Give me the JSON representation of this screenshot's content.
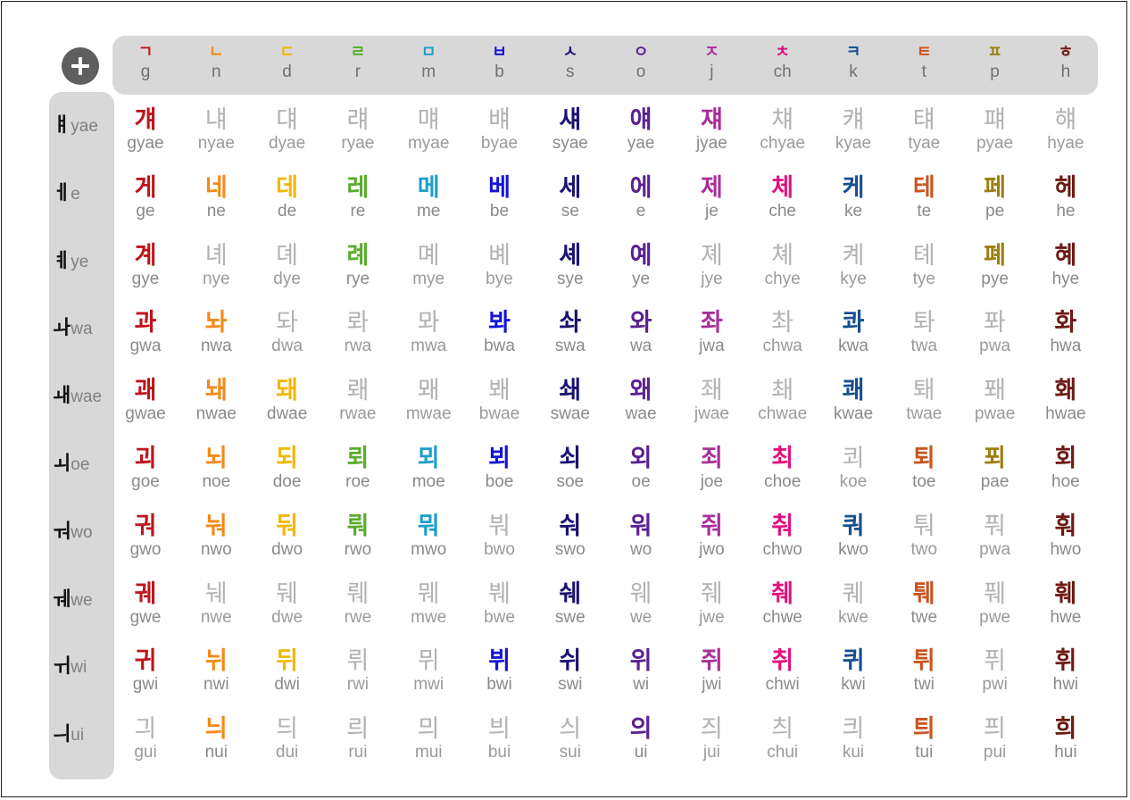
{
  "controls": {
    "add_icon": "plus-circle-icon"
  },
  "consonants": [
    {
      "jamo": "ㄱ",
      "rom": "g",
      "color": "#c0141c"
    },
    {
      "jamo": "ㄴ",
      "rom": "n",
      "color": "#f28a17"
    },
    {
      "jamo": "ㄷ",
      "rom": "d",
      "color": "#f2b705"
    },
    {
      "jamo": "ㄹ",
      "rom": "r",
      "color": "#5aac2e"
    },
    {
      "jamo": "ㅁ",
      "rom": "m",
      "color": "#1e9fc9"
    },
    {
      "jamo": "ㅂ",
      "rom": "b",
      "color": "#1414d6"
    },
    {
      "jamo": "ㅅ",
      "rom": "s",
      "color": "#1a1270"
    },
    {
      "jamo": "ㅇ",
      "rom": "o",
      "color": "#5b2190"
    },
    {
      "jamo": "ㅈ",
      "rom": "j",
      "color": "#a8309a"
    },
    {
      "jamo": "ㅊ",
      "rom": "ch",
      "color": "#e0127e"
    },
    {
      "jamo": "ㅋ",
      "rom": "k",
      "color": "#174f8f"
    },
    {
      "jamo": "ㅌ",
      "rom": "t",
      "color": "#c95420"
    },
    {
      "jamo": "ㅍ",
      "rom": "p",
      "color": "#9c7f10"
    },
    {
      "jamo": "ㅎ",
      "rom": "h",
      "color": "#6e1a14"
    }
  ],
  "rows": [
    {
      "vowel": "ㅒ",
      "vowel_rom": "yae",
      "syllables": [
        "걔",
        "냬",
        "댸",
        "럐",
        "먜",
        "뱨",
        "섀",
        "얘",
        "쟤",
        "챼",
        "컈",
        "턔",
        "퍠",
        "햬"
      ],
      "roms": [
        "gyae",
        "nyae",
        "dyae",
        "ryae",
        "myae",
        "byae",
        "syae",
        "yae",
        "jyae",
        "chyae",
        "kyae",
        "tyae",
        "pyae",
        "hyae"
      ],
      "active": [
        true,
        false,
        false,
        false,
        false,
        false,
        true,
        true,
        true,
        false,
        false,
        false,
        false,
        false
      ]
    },
    {
      "vowel": "ㅔ",
      "vowel_rom": "e",
      "syllables": [
        "게",
        "네",
        "데",
        "레",
        "메",
        "베",
        "세",
        "에",
        "제",
        "체",
        "케",
        "테",
        "페",
        "헤"
      ],
      "roms": [
        "ge",
        "ne",
        "de",
        "re",
        "me",
        "be",
        "se",
        "e",
        "je",
        "che",
        "ke",
        "te",
        "pe",
        "he"
      ],
      "active": [
        true,
        true,
        true,
        true,
        true,
        true,
        true,
        true,
        true,
        true,
        true,
        true,
        true,
        true
      ]
    },
    {
      "vowel": "ㅖ",
      "vowel_rom": "ye",
      "syllables": [
        "계",
        "녜",
        "뎨",
        "례",
        "몌",
        "볘",
        "셰",
        "예",
        "졔",
        "쳬",
        "켸",
        "톄",
        "폐",
        "혜"
      ],
      "roms": [
        "gye",
        "nye",
        "dye",
        "rye",
        "mye",
        "bye",
        "sye",
        "ye",
        "jye",
        "chye",
        "kye",
        "tye",
        "pye",
        "hye"
      ],
      "active": [
        true,
        false,
        false,
        true,
        false,
        false,
        true,
        true,
        false,
        false,
        false,
        false,
        true,
        true
      ]
    },
    {
      "vowel": "ㅘ",
      "vowel_rom": "wa",
      "syllables": [
        "과",
        "놔",
        "돠",
        "롸",
        "뫄",
        "봐",
        "솨",
        "와",
        "좌",
        "촤",
        "콰",
        "톼",
        "퐈",
        "화"
      ],
      "roms": [
        "gwa",
        "nwa",
        "dwa",
        "rwa",
        "mwa",
        "bwa",
        "swa",
        "wa",
        "jwa",
        "chwa",
        "kwa",
        "twa",
        "pwa",
        "hwa"
      ],
      "active": [
        true,
        true,
        false,
        false,
        false,
        true,
        true,
        true,
        true,
        false,
        true,
        false,
        false,
        true
      ]
    },
    {
      "vowel": "ㅙ",
      "vowel_rom": "wae",
      "syllables": [
        "괘",
        "놰",
        "돼",
        "뢔",
        "뫠",
        "봬",
        "쇄",
        "왜",
        "좨",
        "쵀",
        "쾌",
        "퇘",
        "퐤",
        "홰"
      ],
      "roms": [
        "gwae",
        "nwae",
        "dwae",
        "rwae",
        "mwae",
        "bwae",
        "swae",
        "wae",
        "jwae",
        "chwae",
        "kwae",
        "twae",
        "pwae",
        "hwae"
      ],
      "active": [
        true,
        true,
        true,
        false,
        false,
        false,
        true,
        true,
        false,
        false,
        true,
        false,
        false,
        true
      ]
    },
    {
      "vowel": "ㅚ",
      "vowel_rom": "oe",
      "syllables": [
        "괴",
        "뇌",
        "되",
        "뢰",
        "뫼",
        "뵈",
        "쇠",
        "외",
        "죄",
        "최",
        "쾨",
        "퇴",
        "푀",
        "회"
      ],
      "roms": [
        "goe",
        "noe",
        "doe",
        "roe",
        "moe",
        "boe",
        "soe",
        "oe",
        "joe",
        "choe",
        "koe",
        "toe",
        "pae",
        "hoe"
      ],
      "active": [
        true,
        true,
        true,
        true,
        true,
        true,
        true,
        true,
        true,
        true,
        false,
        true,
        true,
        true
      ]
    },
    {
      "vowel": "ㅝ",
      "vowel_rom": "wo",
      "syllables": [
        "궈",
        "눠",
        "둬",
        "뤄",
        "뭐",
        "붜",
        "숴",
        "워",
        "줘",
        "춰",
        "쿼",
        "퉈",
        "풔",
        "훠"
      ],
      "roms": [
        "gwo",
        "nwo",
        "dwo",
        "rwo",
        "mwo",
        "bwo",
        "swo",
        "wo",
        "jwo",
        "chwo",
        "kwo",
        "two",
        "pwa",
        "hwo"
      ],
      "active": [
        true,
        true,
        true,
        true,
        true,
        false,
        true,
        true,
        true,
        true,
        true,
        false,
        false,
        true
      ]
    },
    {
      "vowel": "ㅞ",
      "vowel_rom": "we",
      "syllables": [
        "궤",
        "눼",
        "뒈",
        "뤠",
        "뭬",
        "붸",
        "쉐",
        "웨",
        "줴",
        "췌",
        "퀘",
        "퉤",
        "풰",
        "훼"
      ],
      "roms": [
        "gwe",
        "nwe",
        "dwe",
        "rwe",
        "mwe",
        "bwe",
        "swe",
        "we",
        "jwe",
        "chwe",
        "kwe",
        "twe",
        "pwe",
        "hwe"
      ],
      "active": [
        true,
        false,
        false,
        false,
        false,
        false,
        true,
        false,
        false,
        true,
        false,
        true,
        false,
        true
      ]
    },
    {
      "vowel": "ㅟ",
      "vowel_rom": "wi",
      "syllables": [
        "귀",
        "뉘",
        "뒤",
        "뤼",
        "뮈",
        "뷔",
        "쉬",
        "위",
        "쥐",
        "취",
        "퀴",
        "튀",
        "퓌",
        "휘"
      ],
      "roms": [
        "gwi",
        "nwi",
        "dwi",
        "rwi",
        "mwi",
        "bwi",
        "swi",
        "wi",
        "jwi",
        "chwi",
        "kwi",
        "twi",
        "pwi",
        "hwi"
      ],
      "active": [
        true,
        true,
        true,
        false,
        false,
        true,
        true,
        true,
        true,
        true,
        true,
        true,
        false,
        true
      ]
    },
    {
      "vowel": "ㅢ",
      "vowel_rom": "ui",
      "syllables": [
        "긔",
        "늬",
        "듸",
        "릐",
        "믜",
        "븨",
        "싀",
        "의",
        "즤",
        "츼",
        "킈",
        "틔",
        "픠",
        "희"
      ],
      "roms": [
        "gui",
        "nui",
        "dui",
        "rui",
        "mui",
        "bui",
        "sui",
        "ui",
        "jui",
        "chui",
        "kui",
        "tui",
        "pui",
        "hui"
      ],
      "active": [
        false,
        true,
        false,
        false,
        false,
        false,
        false,
        true,
        false,
        false,
        false,
        true,
        false,
        true
      ]
    }
  ]
}
